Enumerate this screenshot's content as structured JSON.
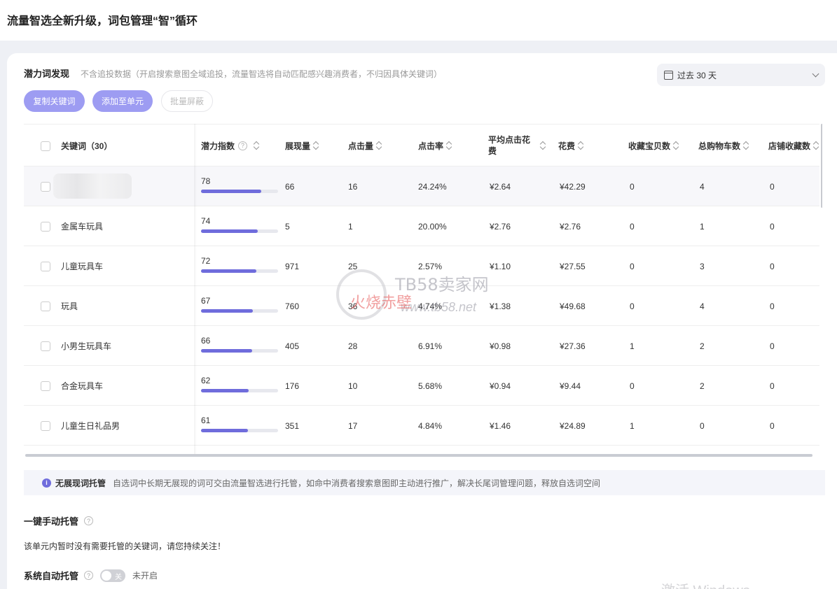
{
  "header": {
    "title": "流量智选全新升级，词包管理“智”循环"
  },
  "section": {
    "title": "潜力词发现",
    "description": "不含追投数据（开启搜索意图全域追投，流量智选将自动匹配感兴趣消费者，不归因具体关键词）",
    "date_range": "过去 30 天"
  },
  "actions": {
    "copy_label": "复制关键词",
    "add_label": "添加至单元",
    "block_label": "批量屏蔽"
  },
  "table": {
    "columns": {
      "keyword": "关键词（30）",
      "potential": "潜力指数",
      "impressions": "展现量",
      "clicks": "点击量",
      "ctr": "点击率",
      "avg_cpc": "平均点击花费",
      "cost": "花费",
      "fav_items": "收藏宝贝数",
      "cart_total": "总购物车数",
      "shop_fav": "店铺收藏数"
    },
    "rows": [
      {
        "keyword": "",
        "potential": "78",
        "potential_pct": 0.78,
        "impressions": "66",
        "clicks": "16",
        "ctr": "24.24%",
        "avg_cpc": "¥2.64",
        "cost": "¥42.29",
        "fav_items": "0",
        "cart_total": "4",
        "shop_fav": "0"
      },
      {
        "keyword": "金属车玩具",
        "potential": "74",
        "potential_pct": 0.74,
        "impressions": "5",
        "clicks": "1",
        "ctr": "20.00%",
        "avg_cpc": "¥2.76",
        "cost": "¥2.76",
        "fav_items": "0",
        "cart_total": "1",
        "shop_fav": "0"
      },
      {
        "keyword": "儿童玩具车",
        "potential": "72",
        "potential_pct": 0.72,
        "impressions": "971",
        "clicks": "25",
        "ctr": "2.57%",
        "avg_cpc": "¥1.10",
        "cost": "¥27.55",
        "fav_items": "0",
        "cart_total": "3",
        "shop_fav": "0"
      },
      {
        "keyword": "玩具",
        "potential": "67",
        "potential_pct": 0.67,
        "impressions": "760",
        "clicks": "36",
        "ctr": "4.74%",
        "avg_cpc": "¥1.38",
        "cost": "¥49.68",
        "fav_items": "0",
        "cart_total": "4",
        "shop_fav": "0"
      },
      {
        "keyword": "小男生玩具车",
        "potential": "66",
        "potential_pct": 0.66,
        "impressions": "405",
        "clicks": "28",
        "ctr": "6.91%",
        "avg_cpc": "¥0.98",
        "cost": "¥27.36",
        "fav_items": "1",
        "cart_total": "2",
        "shop_fav": "0"
      },
      {
        "keyword": "合金玩具车",
        "potential": "62",
        "potential_pct": 0.62,
        "impressions": "176",
        "clicks": "10",
        "ctr": "5.68%",
        "avg_cpc": "¥0.94",
        "cost": "¥9.44",
        "fav_items": "0",
        "cart_total": "2",
        "shop_fav": "0"
      },
      {
        "keyword": "儿童生日礼品男",
        "potential": "61",
        "potential_pct": 0.61,
        "impressions": "351",
        "clicks": "17",
        "ctr": "4.84%",
        "avg_cpc": "¥1.46",
        "cost": "¥24.89",
        "fav_items": "1",
        "cart_total": "0",
        "shop_fav": "0"
      }
    ]
  },
  "notice": {
    "title": "无展现词托管",
    "text": "自选词中长期无展现的词可交由流量智选进行托管，如命中消费者搜索意图即主动进行推广，解决长尾词管理问题，释放自选词空间"
  },
  "manual": {
    "title": "一键手动托管",
    "text": "该单元内暂时没有需要托管的关键词，请您持续关注！"
  },
  "auto": {
    "title": "系统自动托管",
    "toggle_label": "关",
    "state": "未开启"
  },
  "watermark": {
    "brand": "TB58卖家网",
    "url": "www.tb58.net",
    "red_text": "火烧赤壁"
  },
  "os_watermark": "激活 Windows",
  "colors": {
    "accent": "#6f6cdc",
    "button": "#9d9cf2"
  }
}
